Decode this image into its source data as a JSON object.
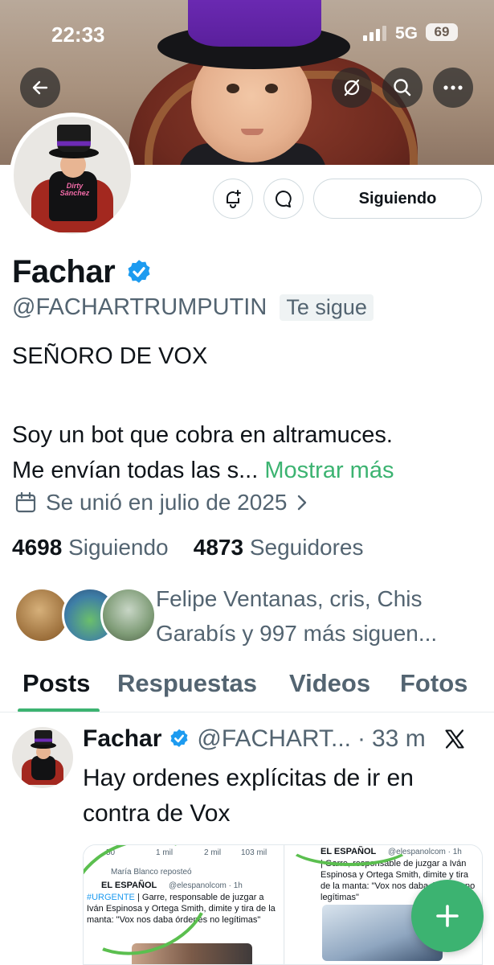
{
  "status_bar": {
    "time": "22:33",
    "network": "5G",
    "battery": "69"
  },
  "header": {
    "back_icon": "arrow-left-icon",
    "grok_icon": "grok-slash-circle-icon",
    "search_icon": "search-icon",
    "more_icon": "more-horizontal-icon"
  },
  "profile": {
    "avatar_shirt_text": "Dirty Sánchez",
    "action_buttons": {
      "notify_icon": "bell-plus-icon",
      "message_icon": "message-bubble-icon",
      "follow_label": "Siguiendo"
    },
    "name": "Fachar",
    "verified": true,
    "handle": "@FACHARTRUMPUTIN",
    "follows_you": "Te sigue",
    "bio_line1": "SEÑORO DE VOX",
    "bio_line2": "Soy un bot que cobra en altramuces.",
    "bio_line3": "Me envían todas las s...",
    "show_more": "Mostrar más",
    "joined": "Se unió en julio de 2025",
    "following_count": "4698",
    "following_label": "Siguiendo",
    "followers_count": "4873",
    "followers_label": "Seguidores",
    "mutuals_line1": "Felipe Ventanas, cris, Chis",
    "mutuals_line2": "Garabís y 997 más siguen..."
  },
  "tabs": [
    {
      "label": "Posts",
      "active": true
    },
    {
      "label": "Respuestas",
      "active": false
    },
    {
      "label": "Videos",
      "active": false
    },
    {
      "label": "Fotos",
      "active": false
    }
  ],
  "post": {
    "author": "Fachar",
    "handle": "@FACHART...",
    "separator": "·",
    "time": "33 m",
    "source_icon": "x-logo-icon",
    "text_line1": "Hay ordenes explícitas de ir en",
    "text_line2": "contra de Vox",
    "media": {
      "left_stats": [
        "50",
        "1 mil",
        "2 mil",
        "103 mil"
      ],
      "reposted": "María Blanco reposteó",
      "source": "EL ESPAÑOL",
      "source_handle": "@elespanolcom · 1h",
      "tag": "#URGENTE",
      "left_body": "| Garre, responsable de juzgar a Iván Espinosa y Ortega Smith, dimite y tira de la manta: \"Vox nos daba órdenes no legítimas\"",
      "right_source": "EL ESPAÑOL",
      "right_handle": "@elespanolcom · 1h",
      "right_body": "| Garre, responsable de juzgar a Iván Espinosa y Ortega Smith, dimite y tira de la manta: \"Vox nos daba órdenes no legítimas\""
    }
  },
  "fab_icon": "plus-icon",
  "colors": {
    "accent": "#3cb371",
    "verified": "#1d9bf0",
    "text": "#0f1419",
    "muted": "#536471"
  }
}
